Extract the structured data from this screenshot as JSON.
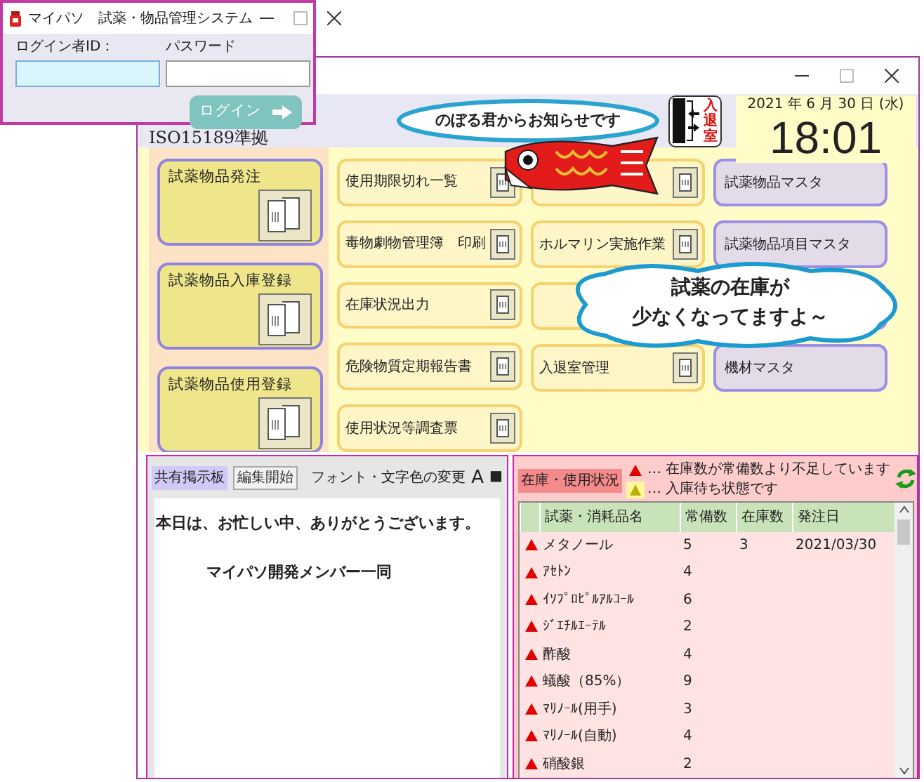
{
  "login_window": {
    "title": "マイパソ　試薬・物品管理システム",
    "id_label": "ログイン者ID：",
    "password_label": "パスワード",
    "id_field": {
      "focused": true
    },
    "password_field": {
      "focused": false
    },
    "login_button": "ログイン"
  },
  "main_window": {
    "standard": "ISO15189準拠",
    "door_sign": "入退室",
    "date": "2021 年 6 月 30 日 (水)",
    "time": "18:01",
    "notice_bubble": "のぼる君からお知らせです",
    "alert_bubble": [
      "試薬の在庫が",
      "少なくなってますよ～"
    ],
    "large_buttons": [
      {
        "label": "試薬物品発注"
      },
      {
        "label": "試薬物品入庫登録"
      },
      {
        "label": "試薬物品使用登録"
      }
    ],
    "menu_columns": [
      {
        "kind": "task",
        "buttons": [
          {
            "kind": "labelled",
            "label": "使用期限切れ一覧"
          },
          {
            "kind": "labelled",
            "label": "毒物劇物管理簿　印刷"
          },
          {
            "kind": "labelled",
            "label": "在庫状況出力"
          },
          {
            "kind": "labelled",
            "label": "危険物質定期報告書"
          },
          {
            "kind": "labelled",
            "label": "使用状況等調査票"
          }
        ]
      },
      {
        "kind": "task",
        "buttons": [
          {
            "kind": "covered"
          },
          {
            "kind": "labelled",
            "label": "ホルマリン実施作業"
          },
          {
            "kind": "covered"
          },
          {
            "kind": "labelled",
            "label": "入退室管理"
          }
        ]
      },
      {
        "kind": "master",
        "buttons": [
          {
            "kind": "labelled",
            "label": "試薬物品マスタ"
          },
          {
            "kind": "labelled",
            "label": "試薬物品項目マスタ"
          },
          {
            "kind": "covered"
          },
          {
            "kind": "labelled",
            "label": "機材マスタ"
          }
        ]
      }
    ]
  },
  "board": {
    "title": "共有掲示板",
    "edit_button": "編集開始",
    "font_label": "フォント・文字色の変更",
    "font_button": "A",
    "color_button": "■",
    "message": [
      "本日は、お忙しい中、ありがとうございます。",
      "マイパソ開発メンバー一同"
    ]
  },
  "stock": {
    "title": "在庫・使用状況",
    "legend": [
      {
        "kind": "shortage",
        "text": "… 在庫数が常備数より不足しています"
      },
      {
        "kind": "waiting",
        "text": "… 入庫待ち状態です"
      }
    ],
    "columns": [
      "試薬・消耗品名",
      "常備数",
      "在庫数",
      "発注日"
    ],
    "rows": [
      {
        "shortage": true,
        "cells": [
          "メタノール",
          "5",
          "3",
          "2021/03/30"
        ]
      },
      {
        "shortage": true,
        "cells": [
          "ｱｾﾄﾝ",
          "4",
          "",
          ""
        ]
      },
      {
        "shortage": true,
        "cells": [
          "ｲｿﾌﾟﾛﾋﾟﾙｱﾙｺｰﾙ",
          "6",
          "",
          ""
        ]
      },
      {
        "shortage": true,
        "cells": [
          "ｼﾞｴﾁﾙｴｰﾃﾙ",
          "2",
          "",
          ""
        ]
      },
      {
        "shortage": true,
        "cells": [
          "酢酸",
          "4",
          "",
          ""
        ]
      },
      {
        "shortage": true,
        "cells": [
          "蟻酸（85%）",
          "9",
          "",
          ""
        ]
      },
      {
        "shortage": true,
        "cells": [
          "ﾏﾘﾉｰﾙ(用手)",
          "3",
          "",
          ""
        ]
      },
      {
        "shortage": true,
        "cells": [
          "ﾏﾘﾉｰﾙ(自動)",
          "4",
          "",
          ""
        ]
      },
      {
        "shortage": true,
        "cells": [
          "硝酸銀",
          "2",
          "",
          ""
        ]
      }
    ]
  }
}
